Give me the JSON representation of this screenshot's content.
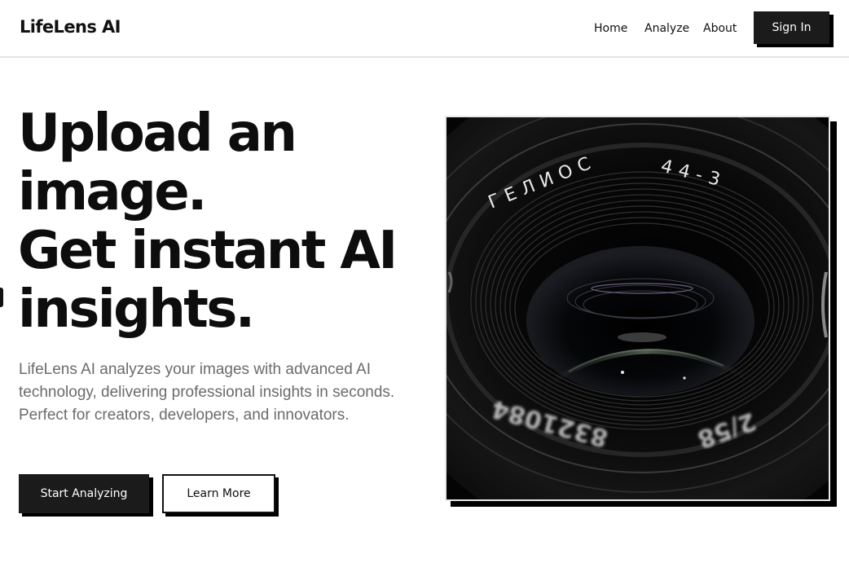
{
  "header": {
    "logo": "LifeLens AI",
    "nav": [
      "Home",
      "Analyze",
      "About"
    ],
    "sign_in_label": "Sign In"
  },
  "hero": {
    "headline_lines": [
      "Upload an",
      "image.",
      "Get instant AI",
      "insights."
    ],
    "description": "LifeLens AI analyzes your images with advanced AI technology, delivering professional insights in seconds. Perfect for creators, developers, and innovators.",
    "primary_button": "Start Analyzing",
    "secondary_button": "Learn More"
  },
  "image": {
    "subject": "camera-lens-photo",
    "lens_text_top": "ГЕЛИОС 44-3",
    "lens_text_bottom": "8321084 2/58"
  },
  "colors": {
    "button_dark": "#1b1b1b",
    "shadow": "#000000",
    "text_muted": "#6b6b6b",
    "header_border": "#e3e3e3"
  }
}
